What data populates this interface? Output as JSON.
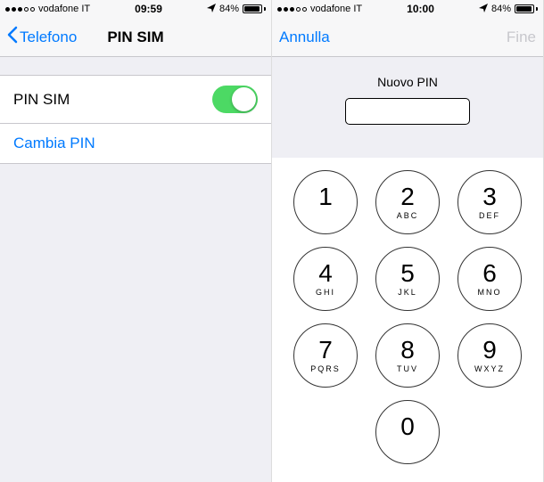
{
  "left": {
    "status": {
      "carrier": "vodafone IT",
      "time": "09:59",
      "battery_pct": "84%"
    },
    "nav": {
      "back": "Telefono",
      "title": "PIN SIM"
    },
    "rows": {
      "pin_sim_label": "PIN SIM",
      "cambia_pin_label": "Cambia PIN"
    }
  },
  "right": {
    "status": {
      "carrier": "vodafone IT",
      "time": "10:00",
      "battery_pct": "84%"
    },
    "nav": {
      "cancel": "Annulla",
      "done": "Fine"
    },
    "pin": {
      "label": "Nuovo PIN",
      "value": ""
    },
    "keypad": [
      {
        "digit": "1",
        "letters": ""
      },
      {
        "digit": "2",
        "letters": "ABC"
      },
      {
        "digit": "3",
        "letters": "DEF"
      },
      {
        "digit": "4",
        "letters": "GHI"
      },
      {
        "digit": "5",
        "letters": "JKL"
      },
      {
        "digit": "6",
        "letters": "MNO"
      },
      {
        "digit": "7",
        "letters": "PQRS"
      },
      {
        "digit": "8",
        "letters": "TUV"
      },
      {
        "digit": "9",
        "letters": "WXYZ"
      },
      {
        "digit": "0",
        "letters": ""
      }
    ]
  },
  "colors": {
    "tint": "#007aff",
    "switch_on": "#4cd964"
  }
}
